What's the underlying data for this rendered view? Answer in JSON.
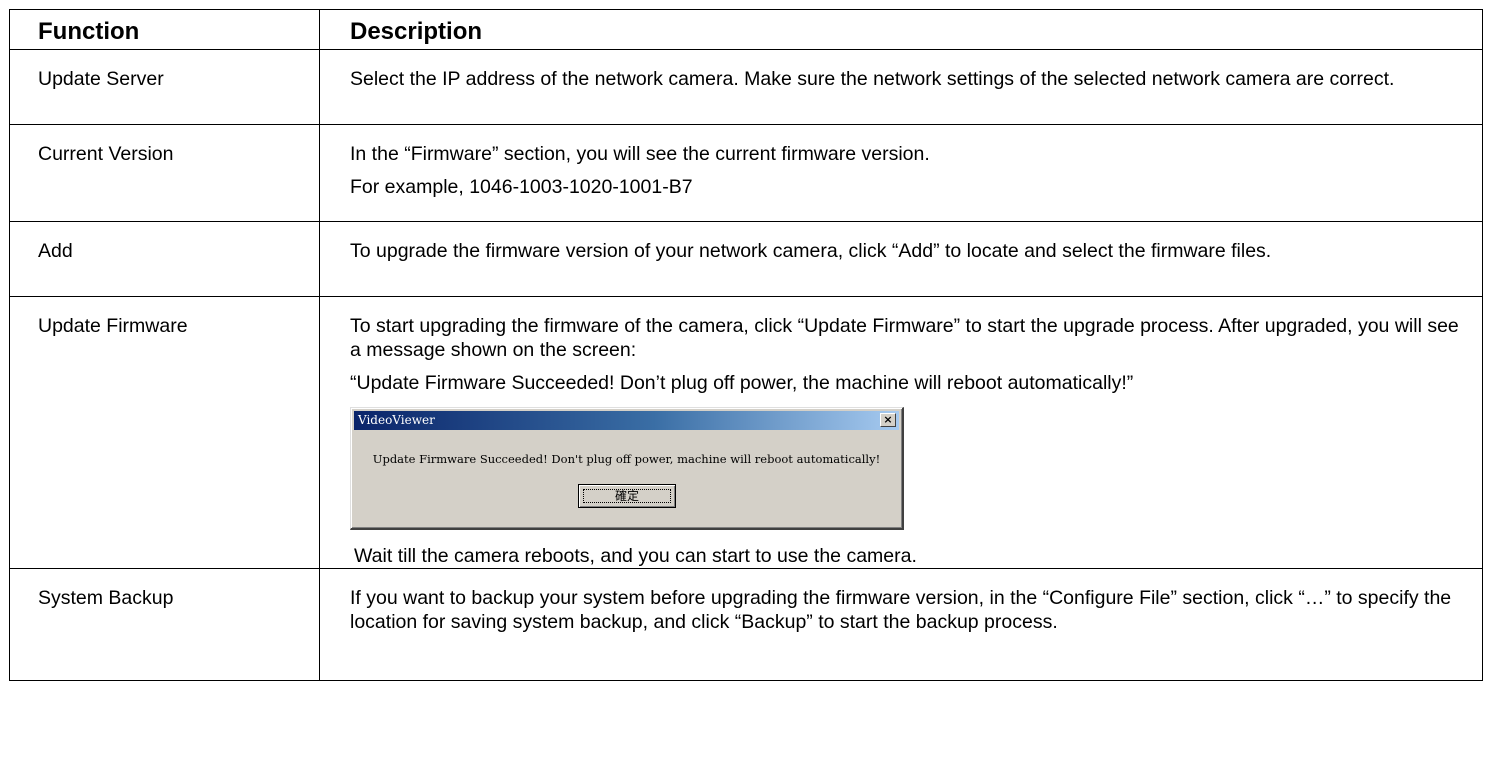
{
  "table": {
    "headers": {
      "function": "Function",
      "description": "Description"
    },
    "rows": {
      "update_server": {
        "function": "Update Server",
        "description": "Select the IP address of the network camera. Make sure the network settings of the selected network camera are correct."
      },
      "current_version": {
        "function": "Current Version",
        "description_1": "In the “Firmware” section, you will see the current firmware version.",
        "description_2": "For example, 1046-1003-1020-1001-B7"
      },
      "add": {
        "function": "Add",
        "description": "To upgrade the firmware version of your network camera, click “Add” to locate and select the firmware files."
      },
      "update_firmware": {
        "function": "Update Firmware",
        "description_1": "To start upgrading the firmware of the camera, click “Update Firmware” to start the upgrade process. After upgraded, you will see a message shown on the screen:",
        "description_2": "“Update Firmware Succeeded! Don’t plug off power, the machine will reboot automatically!”",
        "dialog": {
          "title": "VideoViewer",
          "close_icon": "close-icon",
          "close_glyph": "×",
          "message": "Update Firmware Succeeded! Don't plug off power, machine will reboot automatically!",
          "ok_label": "確定"
        },
        "description_3": "Wait till the camera reboots, and you can start to use the camera."
      },
      "system_backup": {
        "function": "System Backup",
        "description": "If you want to backup your system before upgrading the firmware version, in the “Configure File” section, click “…” to specify the location for saving system backup, and click “Backup” to start the backup process."
      }
    }
  }
}
